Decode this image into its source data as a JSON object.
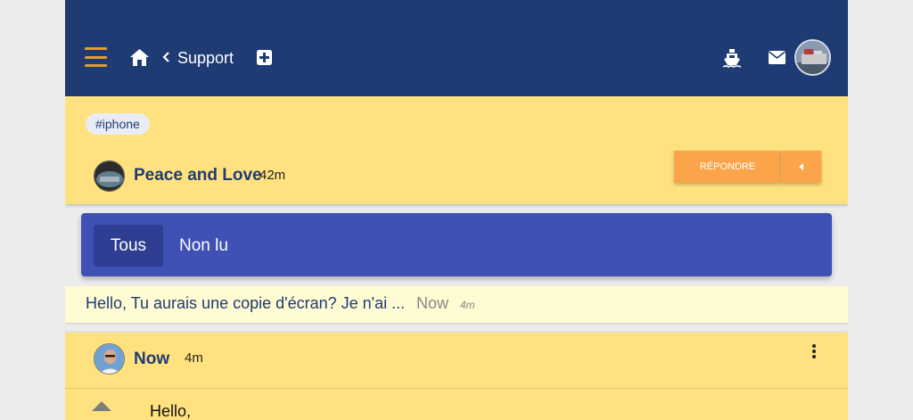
{
  "topbar": {
    "breadcrumb": "Support",
    "colors": {
      "background": "#1f3b73",
      "menu_accent": "#e39b34"
    },
    "icons": [
      "menu-icon",
      "home-icon",
      "chevron-left-icon",
      "plus-square-icon",
      "ship-icon",
      "envelope-icon"
    ]
  },
  "thread": {
    "tag": "#iphone",
    "author": "Peace and Love",
    "time": "42m",
    "reply_label": "RÉPONDRE",
    "colors": {
      "card": "#ffe27f",
      "button": "#fca44a"
    }
  },
  "filters": {
    "tabs": [
      {
        "label": "Tous",
        "active": true
      },
      {
        "label": "Non lu",
        "active": false
      }
    ],
    "colors": {
      "bar": "#3f51b5",
      "active_tab": "#2f3d93"
    }
  },
  "message_preview": {
    "text": "Hello, Tu aurais une copie d'écran? Je n'ai ...",
    "author": "Now",
    "time": "4m",
    "colors": {
      "background": "#fffbd3"
    }
  },
  "post": {
    "author": "Now",
    "time": "4m",
    "body": "Hello,"
  }
}
